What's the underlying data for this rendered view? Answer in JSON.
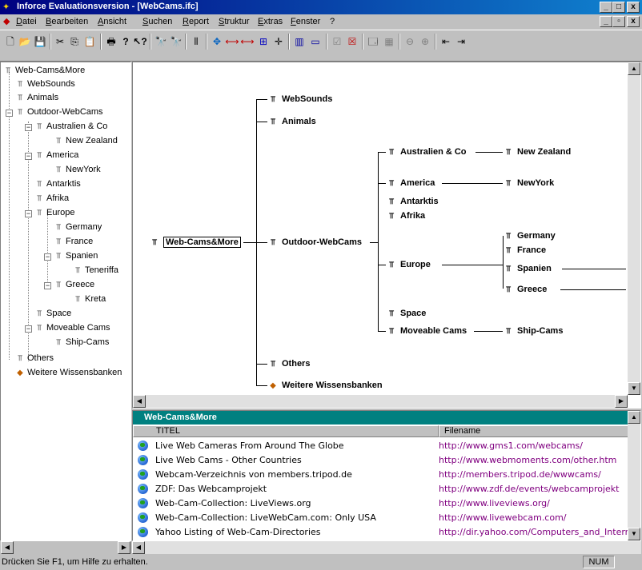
{
  "window": {
    "title": "Inforce Evaluationsversion - [WebCams.ifc]",
    "controls": [
      "_",
      "□",
      "x"
    ],
    "mdi_controls": [
      "_",
      "▫",
      "x"
    ]
  },
  "menu": [
    "Datei",
    "Bearbeiten",
    "Ansicht",
    "Suchen",
    "Report",
    "Struktur",
    "Extras",
    "Fenster",
    "?"
  ],
  "toolbar_icons": [
    "new-icon",
    "open-icon",
    "save-icon",
    "cut-icon",
    "copy-icon",
    "paste-icon",
    "print-icon",
    "help-icon",
    "context-help-icon",
    "find-icon",
    "find-next-icon",
    "columns-icon",
    "move-icon",
    "link-icon",
    "link2-icon",
    "expand-icon",
    "move-cross-icon",
    "split-icon",
    "window-icon",
    "check-icon",
    "check-x-icon",
    "props-icon",
    "grid-icon",
    "zoom-out-icon",
    "zoom-in-icon",
    "fit-icon",
    "fit2-icon"
  ],
  "tree": [
    {
      "label": "Web-Cams&More"
    },
    {
      "label": "WebSounds"
    },
    {
      "label": "Animals"
    },
    {
      "label": "Outdoor-WebCams"
    },
    {
      "label": "Australien & Co"
    },
    {
      "label": "New Zealand"
    },
    {
      "label": "America"
    },
    {
      "label": "NewYork"
    },
    {
      "label": "Antarktis"
    },
    {
      "label": "Afrika"
    },
    {
      "label": "Europe"
    },
    {
      "label": "Germany"
    },
    {
      "label": "France"
    },
    {
      "label": "Spanien"
    },
    {
      "label": "Teneriffa"
    },
    {
      "label": "Greece"
    },
    {
      "label": "Kreta"
    },
    {
      "label": "Space"
    },
    {
      "label": "Moveable Cams"
    },
    {
      "label": "Ship-Cams"
    },
    {
      "label": "Others"
    },
    {
      "label": "Weitere Wissensbanken"
    }
  ],
  "graph": {
    "root": "Web-Cams&More",
    "websounds": "WebSounds",
    "animals": "Animals",
    "outdoor": "Outdoor-WebCams",
    "australien": "Australien & Co",
    "newzealand": "New Zealand",
    "america": "America",
    "newyork": "NewYork",
    "antarktis": "Antarktis",
    "afrika": "Afrika",
    "europe": "Europe",
    "germany": "Germany",
    "france": "France",
    "spanien": "Spanien",
    "greece": "Greece",
    "space": "Space",
    "moveable": "Moveable Cams",
    "shipcams": "Ship-Cams",
    "others": "Others",
    "weitere": "Weitere Wissensbanken"
  },
  "list": {
    "header": "Web-Cams&More",
    "columns": [
      "TITEL",
      "Filename"
    ],
    "rows": [
      {
        "title": "Live Web Cameras From Around The Globe",
        "url": "http://www.gms1.com/webcams/"
      },
      {
        "title": "Live Web Cams - Other Countries",
        "url": "http://www.webmoments.com/other.htm"
      },
      {
        "title": "Webcam-Verzeichnis von members.tripod.de",
        "url": "http://members.tripod.de/wwwcams/"
      },
      {
        "title": "ZDF: Das Webcamprojekt",
        "url": "http://www.zdf.de/events/webcamprojekt"
      },
      {
        "title": "Web-Cam-Collection: LiveViews.org",
        "url": "http://www.liveviews.org/"
      },
      {
        "title": "Web-Cam-Collection: LiveWebCam.com: Only USA",
        "url": "http://www.livewebcam.com/"
      },
      {
        "title": "Yahoo Listing of Web-Cam-Directories",
        "url": "http://dir.yahoo.com/Computers_and_Internet"
      }
    ]
  },
  "status": {
    "message": "Drücken Sie F1, um Hilfe zu erhalten.",
    "num": "NUM"
  }
}
